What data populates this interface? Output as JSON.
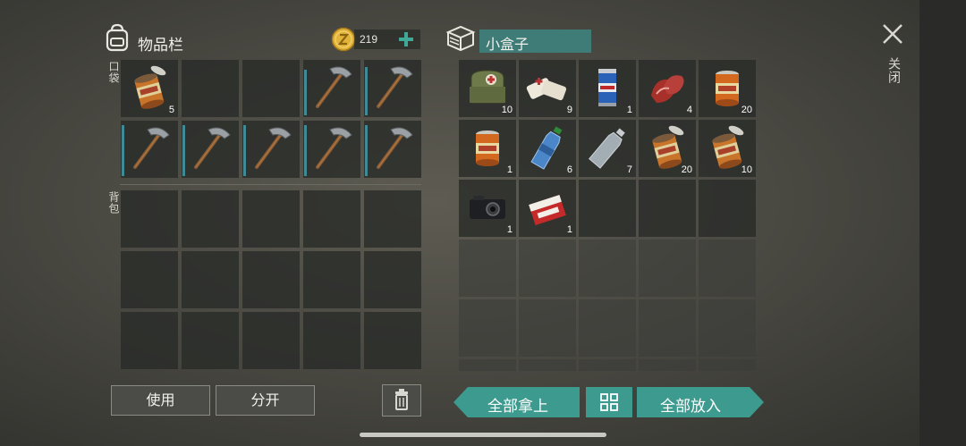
{
  "inventory": {
    "title": "物品栏",
    "coin_amount": "219",
    "pocket_label": "口袋",
    "backpack_label": "背包",
    "pocket_slots": [
      {
        "icon": "food-can-open-icon",
        "qty": "5"
      },
      {
        "icon": "",
        "qty": ""
      },
      {
        "icon": "",
        "qty": ""
      },
      {
        "icon": "pickaxe-icon",
        "qty": "",
        "durability": 0.85
      },
      {
        "icon": "pickaxe-icon",
        "qty": "",
        "durability": 0.9
      },
      {
        "icon": "pickaxe-icon",
        "qty": "",
        "durability": 0.95
      },
      {
        "icon": "pickaxe-icon",
        "qty": "",
        "durability": 0.95
      },
      {
        "icon": "pickaxe-icon",
        "qty": "",
        "durability": 0.95
      },
      {
        "icon": "pickaxe-icon",
        "qty": "",
        "durability": 0.95
      },
      {
        "icon": "pickaxe-icon",
        "qty": "",
        "durability": 0.95
      }
    ],
    "use_button": "使用",
    "split_button": "分开"
  },
  "container": {
    "title": "小盒子",
    "slots": [
      {
        "icon": "first-aid-bag-icon",
        "qty": "10"
      },
      {
        "icon": "bandage-icon",
        "qty": "9"
      },
      {
        "icon": "beer-can-icon",
        "qty": "1"
      },
      {
        "icon": "raw-meat-icon",
        "qty": "4"
      },
      {
        "icon": "food-can-icon",
        "qty": "20"
      },
      {
        "icon": "food-can-icon",
        "qty": "1"
      },
      {
        "icon": "water-bottle-icon",
        "qty": "6"
      },
      {
        "icon": "empty-bottle-icon",
        "qty": "7"
      },
      {
        "icon": "food-can-open-icon",
        "qty": "20"
      },
      {
        "icon": "food-can-open-icon",
        "qty": "10"
      },
      {
        "icon": "camera-icon",
        "qty": "1"
      },
      {
        "icon": "cigarette-pack-icon",
        "qty": "1"
      }
    ],
    "take_all_button": "全部拿上",
    "put_all_button": "全部放入"
  },
  "close_label": "关闭",
  "colors": {
    "accent_teal": "#3d9a8e",
    "coin_gold": "#e2b43a",
    "durability_bar": "#3f8a96"
  }
}
